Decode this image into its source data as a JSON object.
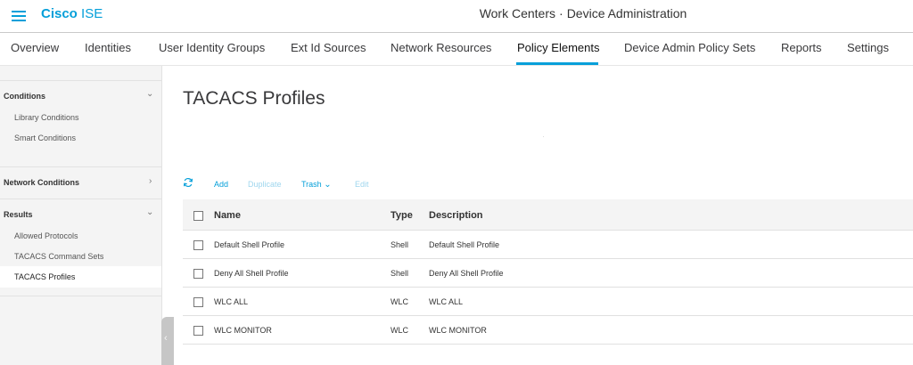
{
  "header": {
    "brand_bold": "Cisco",
    "brand_light": "ISE",
    "title_left": "Work Centers",
    "title_sep": "·",
    "title_right": "Device Administration"
  },
  "nav": {
    "tabs": [
      {
        "label": "Overview"
      },
      {
        "label": "Identities"
      },
      {
        "label": "User Identity Groups"
      },
      {
        "label": "Ext Id Sources"
      },
      {
        "label": "Network Resources"
      },
      {
        "label": "Policy Elements",
        "active": true
      },
      {
        "label": "Device Admin Policy Sets"
      },
      {
        "label": "Reports"
      },
      {
        "label": "Settings"
      }
    ]
  },
  "sidebar": {
    "conditions": {
      "label": "Conditions",
      "items": [
        "Library Conditions",
        "Smart Conditions"
      ]
    },
    "network_conditions": {
      "label": "Network Conditions"
    },
    "results": {
      "label": "Results",
      "items": [
        "Allowed Protocols",
        "TACACS Command Sets",
        "TACACS Profiles"
      ],
      "active_item": "TACACS Profiles"
    }
  },
  "main": {
    "title": "TACACS Profiles",
    "toolbar": {
      "add": "Add",
      "duplicate": "Duplicate",
      "trash": "Trash",
      "edit": "Edit"
    },
    "table": {
      "columns": [
        "Name",
        "Type",
        "Description"
      ],
      "rows": [
        {
          "name": "Default Shell Profile",
          "type": "Shell",
          "description": "Default Shell Profile"
        },
        {
          "name": "Deny All Shell Profile",
          "type": "Shell",
          "description": "Deny All Shell Profile"
        },
        {
          "name": "WLC ALL",
          "type": "WLC",
          "description": "WLC ALL"
        },
        {
          "name": "WLC MONITOR",
          "type": "WLC",
          "description": "WLC MONITOR"
        }
      ]
    }
  },
  "colors": {
    "accent": "#049fd9",
    "disabled": "#9fd6ee",
    "sidebar_bg": "#f4f4f4"
  }
}
